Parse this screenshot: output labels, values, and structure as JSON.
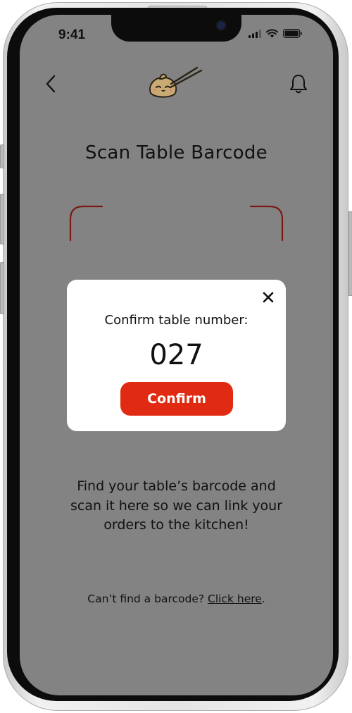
{
  "status_bar": {
    "time": "9:41"
  },
  "nav": {
    "back_icon": "chevron-left-icon",
    "logo_icon": "dumpling-chopsticks-logo",
    "bell_icon": "bell-icon"
  },
  "page": {
    "title": "Scan Table Barcode"
  },
  "modal": {
    "label": "Confirm table number:",
    "table_number": "027",
    "confirm_label": "Confirm",
    "close_icon": "close-icon"
  },
  "instructions": {
    "text": "Find your table’s barcode and scan it here so we can link your orders to the kitchen!"
  },
  "help": {
    "prefix": "Can’t find a barcode? ",
    "link_label": "Click here",
    "suffix": "."
  },
  "colors": {
    "overlay_gray": "#838383",
    "accent_red": "#e12a12",
    "scan_corner": "#7a1a12",
    "logo_skin": "#c9aa72"
  }
}
